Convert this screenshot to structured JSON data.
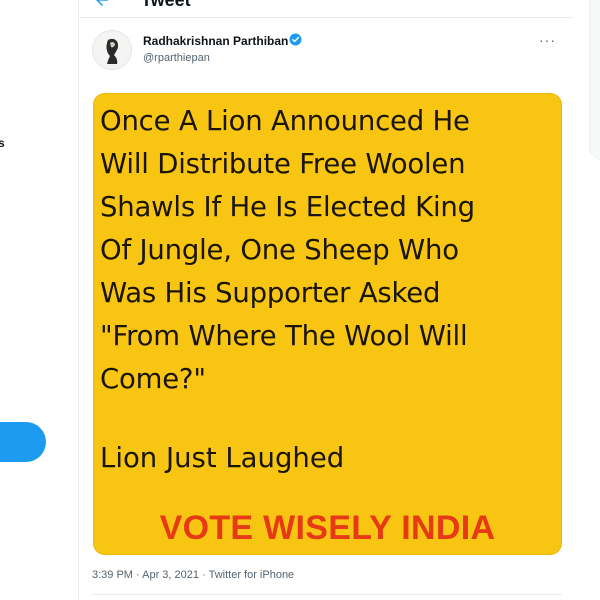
{
  "header": {
    "title": "Tweet"
  },
  "sidebar": {
    "label_fragment": "s"
  },
  "tweet": {
    "author_name": "Radhakrishnan Parthiban",
    "author_handle": "@rparthiepan",
    "more_options": "···",
    "image_text": {
      "lines": [
        "Once A Lion Announced He",
        "Will Distribute Free Woolen",
        "Shawls If He Is Elected King",
        "Of Jungle, One Sheep Who",
        "Was His Supporter Asked",
        "\"From Where The Wool Will",
        "Come?\""
      ],
      "punchline": "Lion Just Laughed",
      "slogan": "VOTE WISELY INDIA"
    },
    "meta": "3:39 PM · Apr 3, 2021 · Twitter for iPhone"
  },
  "colors": {
    "accent": "#1d9bf0",
    "image_background": "#f8c612",
    "slogan": "#e63a14"
  },
  "icons": {
    "back": "back-arrow-icon",
    "verified": "verified-badge-icon",
    "more": "more-options-icon"
  }
}
